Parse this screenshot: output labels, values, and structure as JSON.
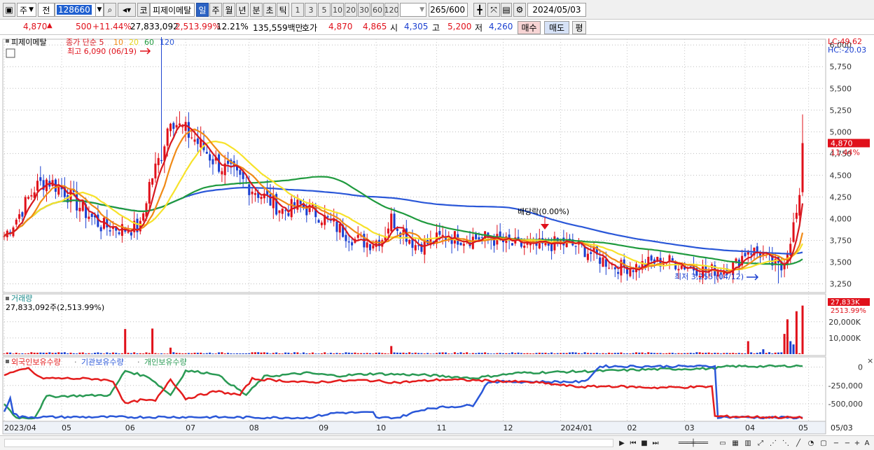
{
  "toolbar": {
    "freq": "주",
    "range": "전",
    "code": "128660",
    "name": "피제이메탈",
    "market": "코",
    "periods": [
      "일",
      "주",
      "월",
      "년",
      "분",
      "초",
      "틱"
    ],
    "nums": [
      "1",
      "3",
      "5",
      "10",
      "20",
      "30",
      "60",
      "120"
    ],
    "count": "265",
    "count_total": "/600",
    "date": "2024/05/03"
  },
  "quote": {
    "price": "4,870",
    "change": "500",
    "change_pct": "+11.44%",
    "volume": "27,833,092",
    "volume_pct": "2,513.99%",
    "turnover": "12.21%",
    "amount": "135,559백만",
    "hoga_label": "호가",
    "ask": "4,870",
    "bid": "4,865",
    "open_label": "시",
    "open": "4,305",
    "high_label": "고",
    "high": "5,200",
    "low_label": "저",
    "low": "4,260",
    "buy": "매수",
    "sell": "매도",
    "eval": "평"
  },
  "colors": {
    "up": "#e0101a",
    "down": "#1a3fd0",
    "ma5": "#d71920",
    "ma10": "#f08a16",
    "ma20": "#f7e22a",
    "ma60": "#1f9a3e",
    "ma120": "#2a57d8",
    "foreign": "#e41c1c",
    "inst": "#2a57d8",
    "indiv": "#2a9a54"
  },
  "chart_data": [
    {
      "type": "candlestick",
      "title": "피제이메탈",
      "legend": [
        {
          "name": "종가 단순 5",
          "color": "#d71920"
        },
        {
          "name": "10",
          "color": "#f08a16"
        },
        {
          "name": "20",
          "color": "#e8d51e"
        },
        {
          "name": "60",
          "color": "#1f9a3e"
        },
        {
          "name": "120",
          "color": "#2a57d8"
        }
      ],
      "y_ticks": [
        "6,000",
        "5,750",
        "5,500",
        "5,250",
        "5,000",
        "4,750",
        "4,500",
        "4,250",
        "4,000",
        "3,750",
        "3,500",
        "3,250"
      ],
      "ylim": [
        3150,
        6050
      ],
      "lc": "LC:49.62",
      "hc": "HC:-20.03",
      "last_price": "4,870",
      "last_pct": "11.44%",
      "high_note": "최고 6,090 (06/19)",
      "low_note": "최저 3,255 (04/12)",
      "dividend_note": "배당락(0.00%)",
      "anchors": [
        {
          "t": 0,
          "v": 3800
        },
        {
          "t": 5,
          "v": 4050
        },
        {
          "t": 10,
          "v": 4350
        },
        {
          "t": 14,
          "v": 4450
        },
        {
          "t": 20,
          "v": 4320
        },
        {
          "t": 26,
          "v": 4100
        },
        {
          "t": 32,
          "v": 3920
        },
        {
          "t": 40,
          "v": 3880
        },
        {
          "t": 45,
          "v": 3900
        },
        {
          "t": 48,
          "v": 4400
        },
        {
          "t": 52,
          "v": 4750
        },
        {
          "t": 55,
          "v": 5200
        },
        {
          "t": 58,
          "v": 5050
        },
        {
          "t": 62,
          "v": 4950
        },
        {
          "t": 66,
          "v": 4800
        },
        {
          "t": 70,
          "v": 4650
        },
        {
          "t": 74,
          "v": 4550
        },
        {
          "t": 80,
          "v": 4400
        },
        {
          "t": 86,
          "v": 4250
        },
        {
          "t": 92,
          "v": 4100
        },
        {
          "t": 98,
          "v": 4150
        },
        {
          "t": 104,
          "v": 4050
        },
        {
          "t": 110,
          "v": 3900
        },
        {
          "t": 116,
          "v": 3760
        },
        {
          "t": 121,
          "v": 3720
        },
        {
          "t": 125,
          "v": 3780
        },
        {
          "t": 128,
          "v": 4000
        },
        {
          "t": 132,
          "v": 3850
        },
        {
          "t": 136,
          "v": 3700
        },
        {
          "t": 140,
          "v": 3720
        },
        {
          "t": 146,
          "v": 3800
        },
        {
          "t": 152,
          "v": 3770
        },
        {
          "t": 160,
          "v": 3780
        },
        {
          "t": 168,
          "v": 3700
        },
        {
          "t": 176,
          "v": 3680
        },
        {
          "t": 184,
          "v": 3720
        },
        {
          "t": 190,
          "v": 3680
        },
        {
          "t": 196,
          "v": 3560
        },
        {
          "t": 202,
          "v": 3450
        },
        {
          "t": 208,
          "v": 3440
        },
        {
          "t": 214,
          "v": 3500
        },
        {
          "t": 220,
          "v": 3510
        },
        {
          "t": 226,
          "v": 3450
        },
        {
          "t": 232,
          "v": 3400
        },
        {
          "t": 238,
          "v": 3420
        },
        {
          "t": 242,
          "v": 3480
        },
        {
          "t": 246,
          "v": 3650
        },
        {
          "t": 250,
          "v": 3600
        },
        {
          "t": 254,
          "v": 3480
        },
        {
          "t": 257,
          "v": 3420
        },
        {
          "t": 260,
          "v": 3780
        },
        {
          "t": 262,
          "v": 4050
        },
        {
          "t": 264,
          "v": 4300
        }
      ]
    },
    {
      "type": "bar",
      "title": "거래량",
      "summary": "27,833,092주(2,513.99%)",
      "y_ticks": [
        "20,000K",
        "10,000K"
      ],
      "last_label": "27,833K",
      "last_pct": "2513.99%",
      "spikes": [
        {
          "t": 40,
          "v": 15500,
          "up": true
        },
        {
          "t": 49,
          "v": 15800,
          "up": true
        },
        {
          "t": 55,
          "v": 4000,
          "up": true
        },
        {
          "t": 128,
          "v": 5000,
          "up": true
        },
        {
          "t": 246,
          "v": 8000,
          "up": true
        },
        {
          "t": 251,
          "v": 3000,
          "up": false
        },
        {
          "t": 258,
          "v": 12500,
          "up": true
        },
        {
          "t": 259,
          "v": 21500,
          "up": true
        },
        {
          "t": 260,
          "v": 8000,
          "up": false
        },
        {
          "t": 261,
          "v": 6000,
          "up": false
        },
        {
          "t": 262,
          "v": 26500,
          "up": true
        },
        {
          "t": 264,
          "v": 30000,
          "up": true
        }
      ]
    },
    {
      "type": "line",
      "legend": [
        "외국인보유수량",
        "기관보유수량",
        "개인보유수량"
      ],
      "y_ticks": [
        "0",
        "-250,000",
        "-500,000"
      ],
      "ylim": [
        -700000,
        100000
      ],
      "foreign": [
        {
          "t": 0,
          "v": -100000
        },
        {
          "t": 8,
          "v": -20000
        },
        {
          "t": 12,
          "v": -150000
        },
        {
          "t": 30,
          "v": -160000
        },
        {
          "t": 36,
          "v": -190000
        },
        {
          "t": 40,
          "v": -500000
        },
        {
          "t": 45,
          "v": -450000
        },
        {
          "t": 50,
          "v": -460000
        },
        {
          "t": 55,
          "v": -160000
        },
        {
          "t": 60,
          "v": -430000
        },
        {
          "t": 70,
          "v": -330000
        },
        {
          "t": 78,
          "v": -380000
        },
        {
          "t": 82,
          "v": -160000
        },
        {
          "t": 90,
          "v": -180000
        },
        {
          "t": 100,
          "v": -210000
        },
        {
          "t": 110,
          "v": -190000
        },
        {
          "t": 120,
          "v": -180000
        },
        {
          "t": 130,
          "v": -210000
        },
        {
          "t": 145,
          "v": -170000
        },
        {
          "t": 160,
          "v": -185000
        },
        {
          "t": 170,
          "v": -200000
        },
        {
          "t": 176,
          "v": -210000
        },
        {
          "t": 190,
          "v": -270000
        },
        {
          "t": 200,
          "v": -260000
        },
        {
          "t": 215,
          "v": -280000
        },
        {
          "t": 230,
          "v": -270000
        },
        {
          "t": 234,
          "v": -265000
        },
        {
          "t": 235,
          "v": -670000
        },
        {
          "t": 250,
          "v": -680000
        },
        {
          "t": 264,
          "v": -690000
        }
      ],
      "inst": [
        {
          "t": 0,
          "v": -620000
        },
        {
          "t": 2,
          "v": -410000
        },
        {
          "t": 3,
          "v": -620000
        },
        {
          "t": 5,
          "v": -680000
        },
        {
          "t": 60,
          "v": -680000
        },
        {
          "t": 100,
          "v": -690000
        },
        {
          "t": 110,
          "v": -620000
        },
        {
          "t": 122,
          "v": -620000
        },
        {
          "t": 123,
          "v": -690000
        },
        {
          "t": 130,
          "v": -690000
        },
        {
          "t": 140,
          "v": -560000
        },
        {
          "t": 155,
          "v": -520000
        },
        {
          "t": 160,
          "v": -200000
        },
        {
          "t": 192,
          "v": -200000
        },
        {
          "t": 197,
          "v": 10000
        },
        {
          "t": 235,
          "v": 10000
        },
        {
          "t": 236,
          "v": -680000
        },
        {
          "t": 264,
          "v": -690000
        }
      ],
      "indiv": [
        {
          "t": 0,
          "v": -500000
        },
        {
          "t": 4,
          "v": -690000
        },
        {
          "t": 10,
          "v": -690000
        },
        {
          "t": 14,
          "v": -400000
        },
        {
          "t": 35,
          "v": -380000
        },
        {
          "t": 40,
          "v": -50000
        },
        {
          "t": 48,
          "v": -140000
        },
        {
          "t": 55,
          "v": -380000
        },
        {
          "t": 60,
          "v": -50000
        },
        {
          "t": 70,
          "v": -90000
        },
        {
          "t": 80,
          "v": -380000
        },
        {
          "t": 86,
          "v": -130000
        },
        {
          "t": 100,
          "v": -80000
        },
        {
          "t": 110,
          "v": -120000
        },
        {
          "t": 122,
          "v": -90000
        },
        {
          "t": 140,
          "v": -110000
        },
        {
          "t": 155,
          "v": -150000
        },
        {
          "t": 170,
          "v": -80000
        },
        {
          "t": 190,
          "v": -60000
        },
        {
          "t": 200,
          "v": -50000
        },
        {
          "t": 215,
          "v": -30000
        },
        {
          "t": 234,
          "v": -20000
        },
        {
          "t": 240,
          "v": 10000
        },
        {
          "t": 255,
          "v": 10000
        },
        {
          "t": 264,
          "v": 20000
        }
      ]
    }
  ],
  "x_axis": {
    "labels": [
      {
        "t": 0,
        "label": "2023/04"
      },
      {
        "t": 19,
        "label": "05"
      },
      {
        "t": 40,
        "label": "06"
      },
      {
        "t": 60,
        "label": "07"
      },
      {
        "t": 81,
        "label": "08"
      },
      {
        "t": 104,
        "label": "09"
      },
      {
        "t": 123,
        "label": "10"
      },
      {
        "t": 143,
        "label": "11"
      },
      {
        "t": 165,
        "label": "12"
      },
      {
        "t": 184,
        "label": "2024/01"
      },
      {
        "t": 206,
        "label": "02"
      },
      {
        "t": 225,
        "label": "03"
      },
      {
        "t": 245,
        "label": "04"
      },
      {
        "t": 266,
        "label": "05"
      }
    ],
    "right_label": "05/03"
  },
  "panel2_title": "거래량",
  "panel3_legend": {
    "foreign": "외국인보유수량",
    "inst": "기관보유수량",
    "indiv": "개인보유수량"
  }
}
